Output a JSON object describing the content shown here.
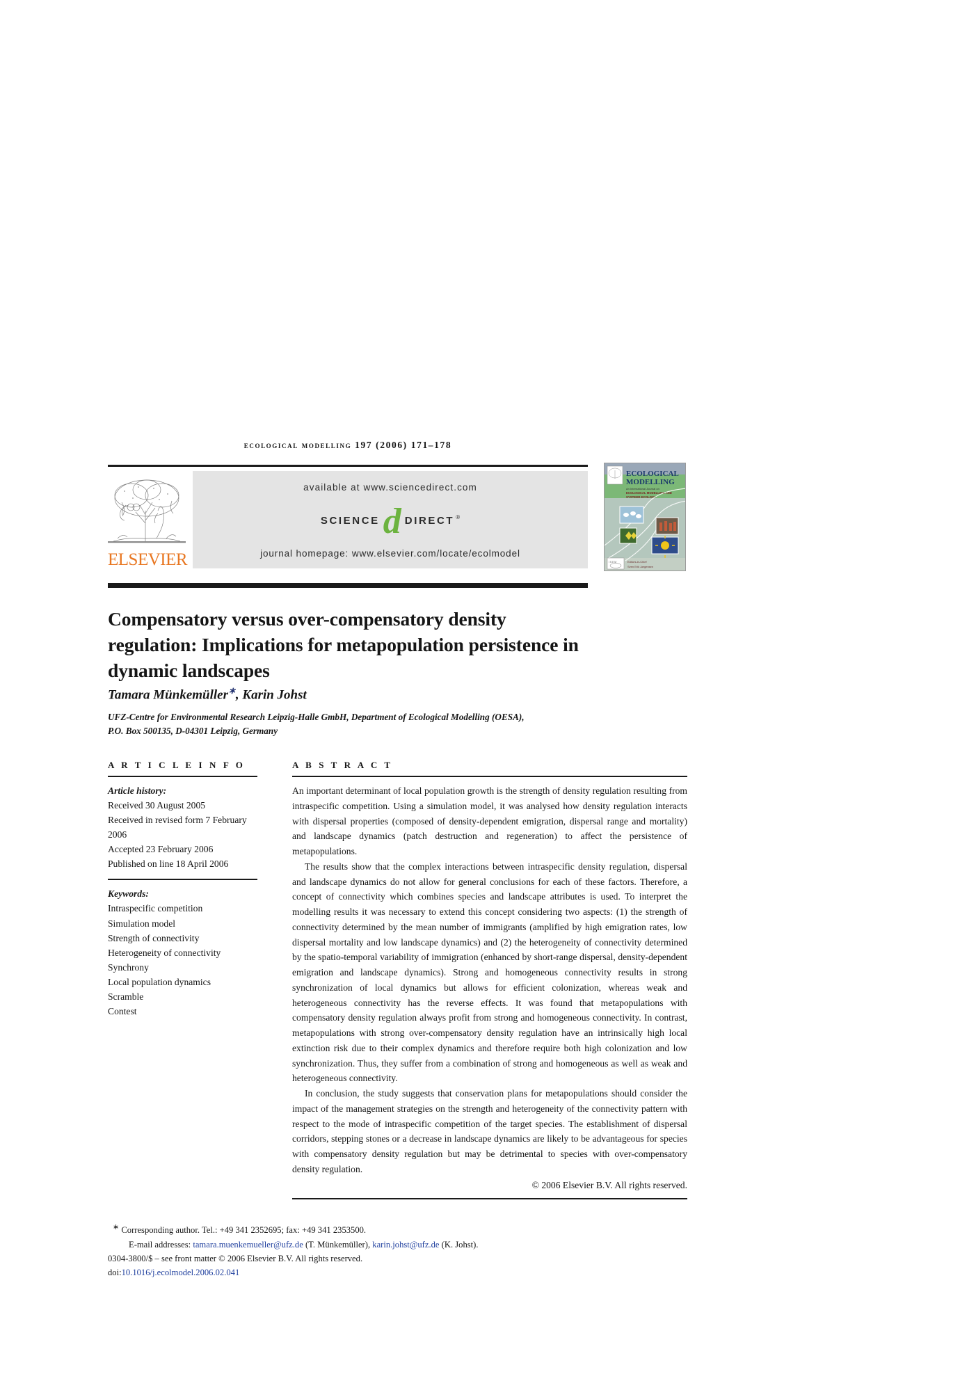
{
  "running_head": "Ecological Modelling 197 (2006) 171–178",
  "masthead": {
    "available_at": "available at www.sciencedirect.com",
    "science_word": "SCIENCE",
    "direct_word": "DIRECT",
    "direct_mark": "®",
    "d_glyph": "d",
    "journal_homepage": "journal homepage: www.elsevier.com/locate/ecolmodel",
    "publisher_name": "ELSEVIER",
    "publisher_color": "#e87722",
    "sciencedirect_green": "#6cb33f"
  },
  "cover": {
    "title_line1": "ECOLOGICAL",
    "title_line2": "MODELLING",
    "subtitle_line1": "An International Journal on",
    "subtitle_line2": "ECOLOGICAL MODELLING AND",
    "subtitle_line3": "SYSTEMS ECOLOGY",
    "editor_line1": "Editors-in-Chief",
    "editor_line2": "Sven Erik Jørgensen"
  },
  "article": {
    "title": "Compensatory versus over-compensatory density regulation: Implications for metapopulation persistence in dynamic landscapes",
    "authors_html": "Tamara Münkemüller<sup>∗</sup>, Karin Johst",
    "affiliation_line1": "UFZ-Centre for Environmental Research Leipzig-Halle GmbH, Department of Ecological Modelling (OESA),",
    "affiliation_line2": "P.O. Box 500135, D-04301 Leipzig, Germany"
  },
  "article_info": {
    "heading": "A R T I C L E   I N F O",
    "history_label": "Article history:",
    "history": [
      "Received 30 August 2005",
      "Received in revised form 7 February 2006",
      "Accepted 23 February 2006",
      "Published on line 18 April 2006"
    ],
    "keywords_label": "Keywords:",
    "keywords": [
      "Intraspecific competition",
      "Simulation model",
      "Strength of connectivity",
      "Heterogeneity of connectivity",
      "Synchrony",
      "Local population dynamics",
      "Scramble",
      "Contest"
    ]
  },
  "abstract": {
    "heading": "A B S T R A C T",
    "paragraphs": [
      "An important determinant of local population growth is the strength of density regulation resulting from intraspecific competition. Using a simulation model, it was analysed how density regulation interacts with dispersal properties (composed of density-dependent emigration, dispersal range and mortality) and landscape dynamics (patch destruction and regeneration) to affect the persistence of metapopulations.",
      "The results show that the complex interactions between intraspecific density regulation, dispersal and landscape dynamics do not allow for general conclusions for each of these factors. Therefore, a concept of connectivity which combines species and landscape attributes is used. To interpret the modelling results it was necessary to extend this concept considering two aspects: (1) the strength of connectivity determined by the mean number of immigrants (amplified by high emigration rates, low dispersal mortality and low landscape dynamics) and (2) the heterogeneity of connectivity determined by the spatio-temporal variability of immigration (enhanced by short-range dispersal, density-dependent emigration and landscape dynamics). Strong and homogeneous connectivity results in strong synchronization of local dynamics but allows for efficient colonization, whereas weak and heterogeneous connectivity has the reverse effects. It was found that metapopulations with compensatory density regulation always profit from strong and homogeneous connectivity. In contrast, metapopulations with strong over-compensatory density regulation have an intrinsically high local extinction risk due to their complex dynamics and therefore require both high colonization and low synchronization. Thus, they suffer from a combination of strong and homogeneous as well as weak and heterogeneous connectivity.",
      "In conclusion, the study suggests that conservation plans for metapopulations should consider the impact of the management strategies on the strength and heterogeneity of the connectivity pattern with respect to the mode of intraspecific competition of the target species. The establishment of dispersal corridors, stepping stones or a decrease in landscape dynamics are likely to be advantageous for species with compensatory density regulation but may be detrimental to species with over-compensatory density regulation."
    ],
    "copyright": "© 2006 Elsevier B.V. All rights reserved."
  },
  "footnote": {
    "corresponding_marker": "∗",
    "corresponding_text": "Corresponding author. Tel.: +49 341 2352695; fax: +49 341 2353500.",
    "email_label": "E-mail addresses:",
    "email1": "tamara.muenkemueller@ufz.de",
    "email1_name": "(T. Münkemüller),",
    "email2": "karin.johst@ufz.de",
    "email2_name": "(K. Johst).",
    "issn_line": "0304-3800/$ – see front matter © 2006 Elsevier B.V. All rights reserved.",
    "doi_label": "doi:",
    "doi_value": "10.1016/j.ecolmodel.2006.02.041",
    "link_color": "#1f3f9e"
  }
}
